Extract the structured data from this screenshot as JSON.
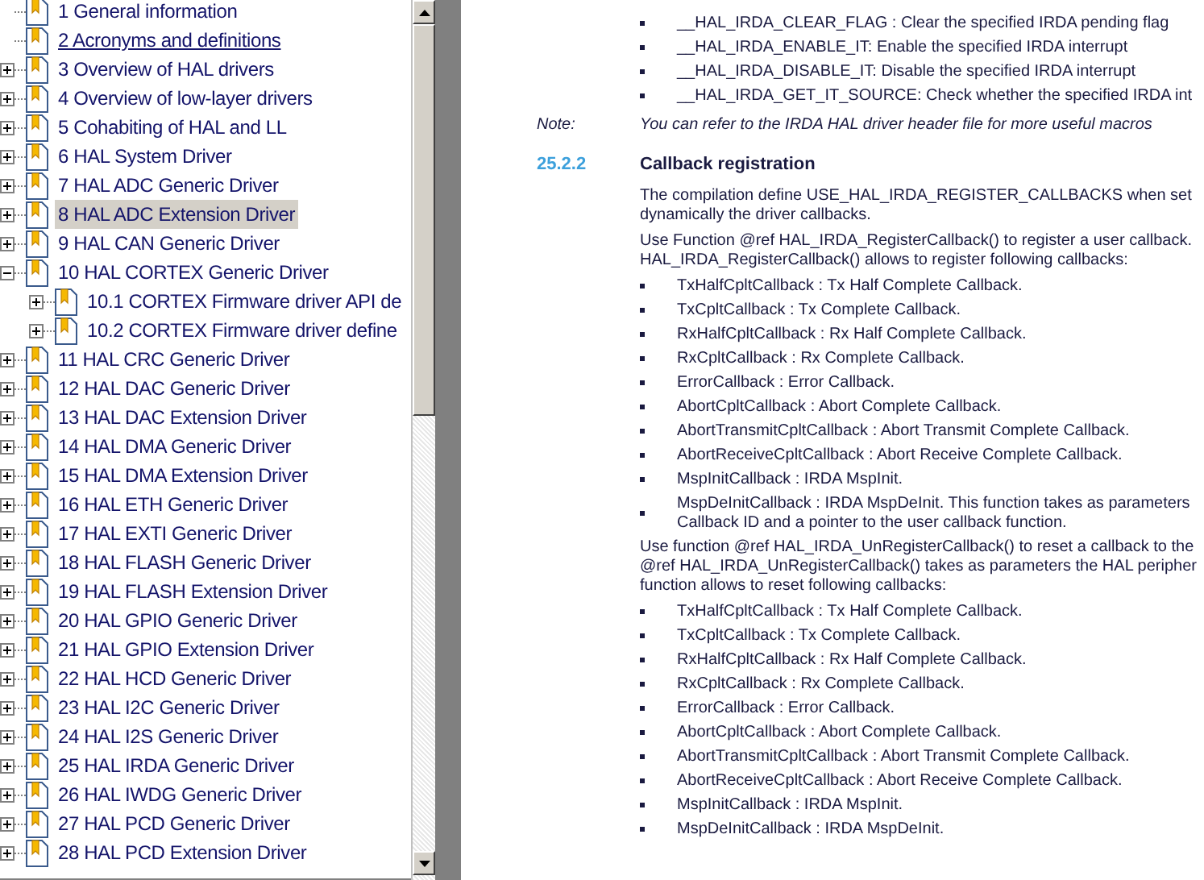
{
  "bookmarks": [
    {
      "label": "1 General information",
      "expandable": false,
      "selected": false,
      "underlined": false
    },
    {
      "label": "2 Acronyms and definitions",
      "expandable": false,
      "selected": false,
      "underlined": true
    },
    {
      "label": "3 Overview of HAL drivers",
      "expandable": true,
      "expanded": false,
      "selected": false,
      "underlined": false
    },
    {
      "label": "4 Overview of low-layer drivers",
      "expandable": true,
      "expanded": false,
      "selected": false,
      "underlined": false
    },
    {
      "label": "5 Cohabiting of HAL and LL",
      "expandable": true,
      "expanded": false,
      "selected": false,
      "underlined": false
    },
    {
      "label": "6 HAL System Driver",
      "expandable": true,
      "expanded": false,
      "selected": false,
      "underlined": false
    },
    {
      "label": "7 HAL ADC Generic Driver",
      "expandable": true,
      "expanded": false,
      "selected": false,
      "underlined": false
    },
    {
      "label": "8 HAL ADC Extension Driver",
      "expandable": true,
      "expanded": false,
      "selected": true,
      "underlined": false
    },
    {
      "label": "9 HAL CAN Generic Driver",
      "expandable": true,
      "expanded": false,
      "selected": false,
      "underlined": false
    },
    {
      "label": "10 HAL CORTEX Generic Driver",
      "expandable": true,
      "expanded": true,
      "selected": false,
      "underlined": false,
      "children": [
        {
          "label": "10.1 CORTEX Firmware driver API de",
          "expandable": true,
          "expanded": false,
          "selected": false,
          "underlined": false
        },
        {
          "label": "10.2 CORTEX Firmware driver define",
          "expandable": true,
          "expanded": false,
          "selected": false,
          "underlined": false
        }
      ]
    },
    {
      "label": "11 HAL CRC Generic Driver",
      "expandable": true,
      "expanded": false,
      "selected": false,
      "underlined": false
    },
    {
      "label": "12 HAL DAC Generic Driver",
      "expandable": true,
      "expanded": false,
      "selected": false,
      "underlined": false
    },
    {
      "label": "13 HAL DAC Extension Driver",
      "expandable": true,
      "expanded": false,
      "selected": false,
      "underlined": false
    },
    {
      "label": "14 HAL DMA Generic Driver",
      "expandable": true,
      "expanded": false,
      "selected": false,
      "underlined": false
    },
    {
      "label": "15 HAL DMA Extension Driver",
      "expandable": true,
      "expanded": false,
      "selected": false,
      "underlined": false
    },
    {
      "label": "16 HAL ETH Generic Driver",
      "expandable": true,
      "expanded": false,
      "selected": false,
      "underlined": false
    },
    {
      "label": "17 HAL EXTI Generic Driver",
      "expandable": true,
      "expanded": false,
      "selected": false,
      "underlined": false
    },
    {
      "label": "18 HAL FLASH Generic Driver",
      "expandable": true,
      "expanded": false,
      "selected": false,
      "underlined": false
    },
    {
      "label": "19 HAL FLASH Extension Driver",
      "expandable": true,
      "expanded": false,
      "selected": false,
      "underlined": false
    },
    {
      "label": "20 HAL GPIO Generic Driver",
      "expandable": true,
      "expanded": false,
      "selected": false,
      "underlined": false
    },
    {
      "label": "21 HAL GPIO Extension Driver",
      "expandable": true,
      "expanded": false,
      "selected": false,
      "underlined": false
    },
    {
      "label": "22 HAL HCD Generic Driver",
      "expandable": true,
      "expanded": false,
      "selected": false,
      "underlined": false
    },
    {
      "label": "23 HAL I2C Generic Driver",
      "expandable": true,
      "expanded": false,
      "selected": false,
      "underlined": false
    },
    {
      "label": "24 HAL I2S Generic Driver",
      "expandable": true,
      "expanded": false,
      "selected": false,
      "underlined": false
    },
    {
      "label": "25 HAL IRDA Generic Driver",
      "expandable": true,
      "expanded": false,
      "selected": false,
      "underlined": false
    },
    {
      "label": "26 HAL IWDG Generic Driver",
      "expandable": true,
      "expanded": false,
      "selected": false,
      "underlined": false
    },
    {
      "label": "27 HAL PCD Generic Driver",
      "expandable": true,
      "expanded": false,
      "selected": false,
      "underlined": false
    },
    {
      "label": "28 HAL PCD Extension Driver",
      "expandable": true,
      "expanded": false,
      "selected": false,
      "underlined": false
    }
  ],
  "document": [
    {
      "kind": "bullet",
      "text": "__HAL_IRDA_CLEAR_FLAG : Clear the specified IRDA pending flag"
    },
    {
      "kind": "bullet",
      "text": "__HAL_IRDA_ENABLE_IT: Enable the specified IRDA interrupt"
    },
    {
      "kind": "bullet",
      "text": "__HAL_IRDA_DISABLE_IT: Disable the specified IRDA interrupt"
    },
    {
      "kind": "bullet",
      "text": "__HAL_IRDA_GET_IT_SOURCE: Check whether the specified IRDA int"
    },
    {
      "kind": "note",
      "label": "Note:",
      "text": "You can refer to the IRDA HAL driver header file for more useful macros"
    },
    {
      "kind": "heading",
      "number": "25.2.2",
      "text": "Callback registration"
    },
    {
      "kind": "paragraph",
      "lines": [
        "The compilation define USE_HAL_IRDA_REGISTER_CALLBACKS when set",
        "dynamically the driver callbacks."
      ]
    },
    {
      "kind": "paragraph",
      "lines": [
        "Use Function @ref HAL_IRDA_RegisterCallback() to register a user callback.",
        "HAL_IRDA_RegisterCallback() allows to register following callbacks:"
      ]
    },
    {
      "kind": "bullet",
      "text": "TxHalfCpltCallback : Tx Half Complete Callback."
    },
    {
      "kind": "bullet",
      "text": "TxCpltCallback : Tx Complete Callback."
    },
    {
      "kind": "bullet",
      "text": "RxHalfCpltCallback : Rx Half Complete Callback."
    },
    {
      "kind": "bullet",
      "text": "RxCpltCallback : Rx Complete Callback."
    },
    {
      "kind": "bullet",
      "text": "ErrorCallback : Error Callback."
    },
    {
      "kind": "bullet",
      "text": "AbortCpltCallback : Abort Complete Callback."
    },
    {
      "kind": "bullet",
      "text": "AbortTransmitCpltCallback : Abort Transmit Complete Callback."
    },
    {
      "kind": "bullet",
      "text": "AbortReceiveCpltCallback : Abort Receive Complete Callback."
    },
    {
      "kind": "bullet",
      "text": "MspInitCallback : IRDA MspInit."
    },
    {
      "kind": "bullet",
      "text": "MspDeInitCallback : IRDA MspDeInit. This function takes as parameters",
      "continuation": "Callback ID and a pointer to the user callback function."
    },
    {
      "kind": "paragraph",
      "lines": [
        "Use function @ref HAL_IRDA_UnRegisterCallback() to reset a callback to the",
        "@ref HAL_IRDA_UnRegisterCallback() takes as parameters the HAL peripher",
        "function allows to reset following callbacks:"
      ]
    },
    {
      "kind": "bullet",
      "text": "TxHalfCpltCallback : Tx Half Complete Callback."
    },
    {
      "kind": "bullet",
      "text": "TxCpltCallback : Tx Complete Callback."
    },
    {
      "kind": "bullet",
      "text": "RxHalfCpltCallback : Rx Half Complete Callback."
    },
    {
      "kind": "bullet",
      "text": "RxCpltCallback : Rx Complete Callback."
    },
    {
      "kind": "bullet",
      "text": "ErrorCallback : Error Callback."
    },
    {
      "kind": "bullet",
      "text": "AbortCpltCallback : Abort Complete Callback."
    },
    {
      "kind": "bullet",
      "text": "AbortTransmitCpltCallback : Abort Transmit Complete Callback."
    },
    {
      "kind": "bullet",
      "text": "AbortReceiveCpltCallback : Abort Receive Complete Callback."
    },
    {
      "kind": "bullet",
      "text": "MspInitCallback : IRDA MspInit."
    },
    {
      "kind": "bullet",
      "text": "MspDeInitCallback : IRDA MspDeInit."
    }
  ]
}
